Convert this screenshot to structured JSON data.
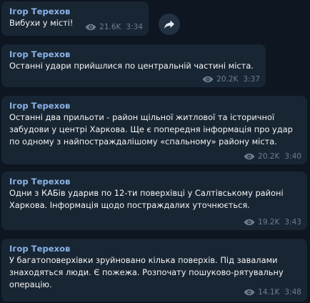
{
  "messages": [
    {
      "author": "Ігор Терехов",
      "lines": [
        "Вибухи у місті!"
      ],
      "views": "21.6K",
      "time": "3:34"
    },
    {
      "author": "Ігор Терехов",
      "lines": [
        "Останні удари прийшлися по центральній частині міста."
      ],
      "views": "20.2K",
      "time": "3:37"
    },
    {
      "author": "Ігор Терехов",
      "lines": [
        "Останні два прильоти - район щільної житлової та історичної",
        "забудови у центрі Харкова. Ще є попередня інформація про удар",
        "по одному з найпостраждалішому «спальному» району міста."
      ],
      "views": "20.2K",
      "time": "3:40"
    },
    {
      "author": "Ігор Терехов",
      "lines": [
        "Одни з КАБів ударив по 12-ти поверхівці у Салтівському районі",
        "Харкова. Інформація щодо постраждалих уточнюється."
      ],
      "views": "19.2K",
      "time": "3:43"
    },
    {
      "author": "Ігор Терехов",
      "lines": [
        "У багатоповерхівки зруйновано кілька поверхів. Під завалами",
        "знаходяться люди. Є пожежа. Розпочату пошуково-рятувальну",
        "операцію."
      ],
      "views": "14.1K",
      "time": "3:48"
    }
  ],
  "icons": {
    "views": "eye-icon",
    "share": "share-arrow-icon"
  },
  "colors": {
    "background": "#0e1621",
    "bubble": "#182533",
    "author": "#8ab4e8",
    "meta": "#6d7f8f"
  }
}
